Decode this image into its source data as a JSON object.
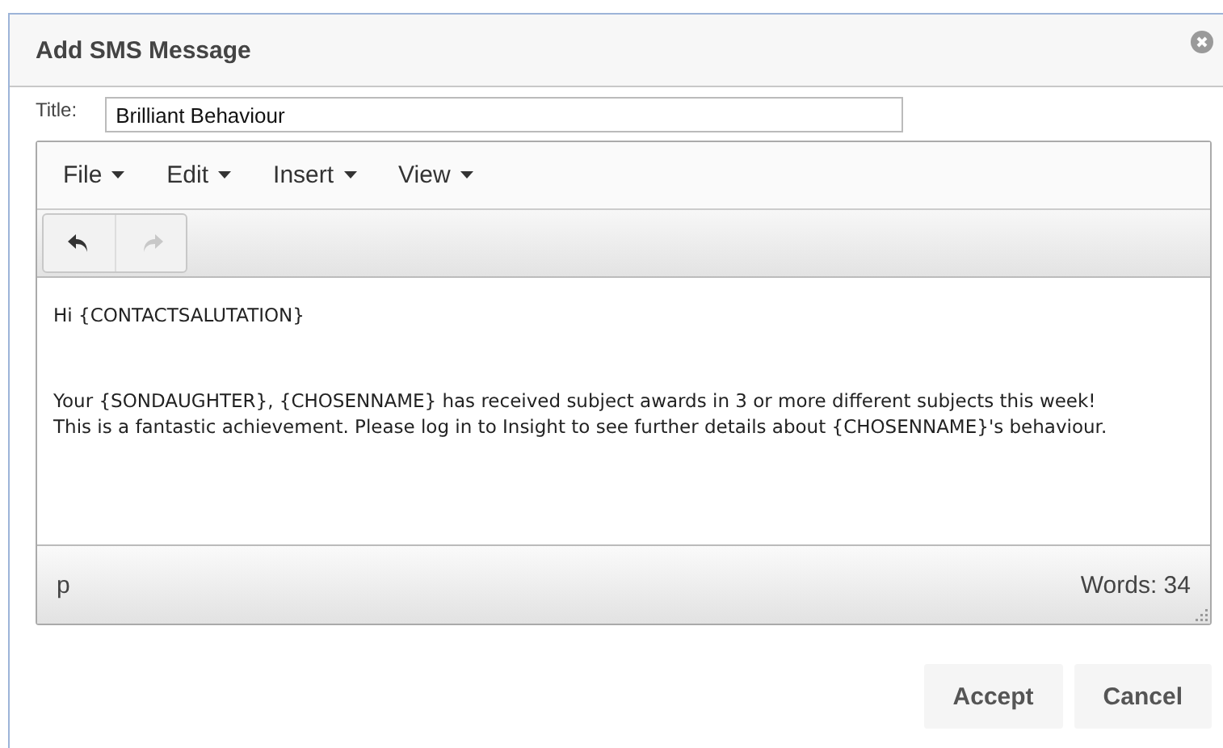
{
  "dialog": {
    "title": "Add SMS Message"
  },
  "title_field": {
    "label": "Title:",
    "value": "Brilliant Behaviour"
  },
  "editor": {
    "menus": [
      {
        "label": "File"
      },
      {
        "label": "Edit"
      },
      {
        "label": "Insert"
      },
      {
        "label": "View"
      }
    ],
    "toolbar": [
      {
        "kind": "undo",
        "disabled": false
      },
      {
        "kind": "redo",
        "disabled": true
      }
    ],
    "paragraphs": [
      "Hi {CONTACTSALUTATION}",
      "Your {SONDAUGHTER}, {CHOSENNAME} has received subject awards in 3 or more different subjects this week! This is a fantastic achievement. Please log in to Insight to see further details about {CHOSENNAME}'s behaviour."
    ],
    "path": "p",
    "word_count": "Words: 34"
  },
  "buttons": [
    "Accept",
    "Cancel"
  ]
}
